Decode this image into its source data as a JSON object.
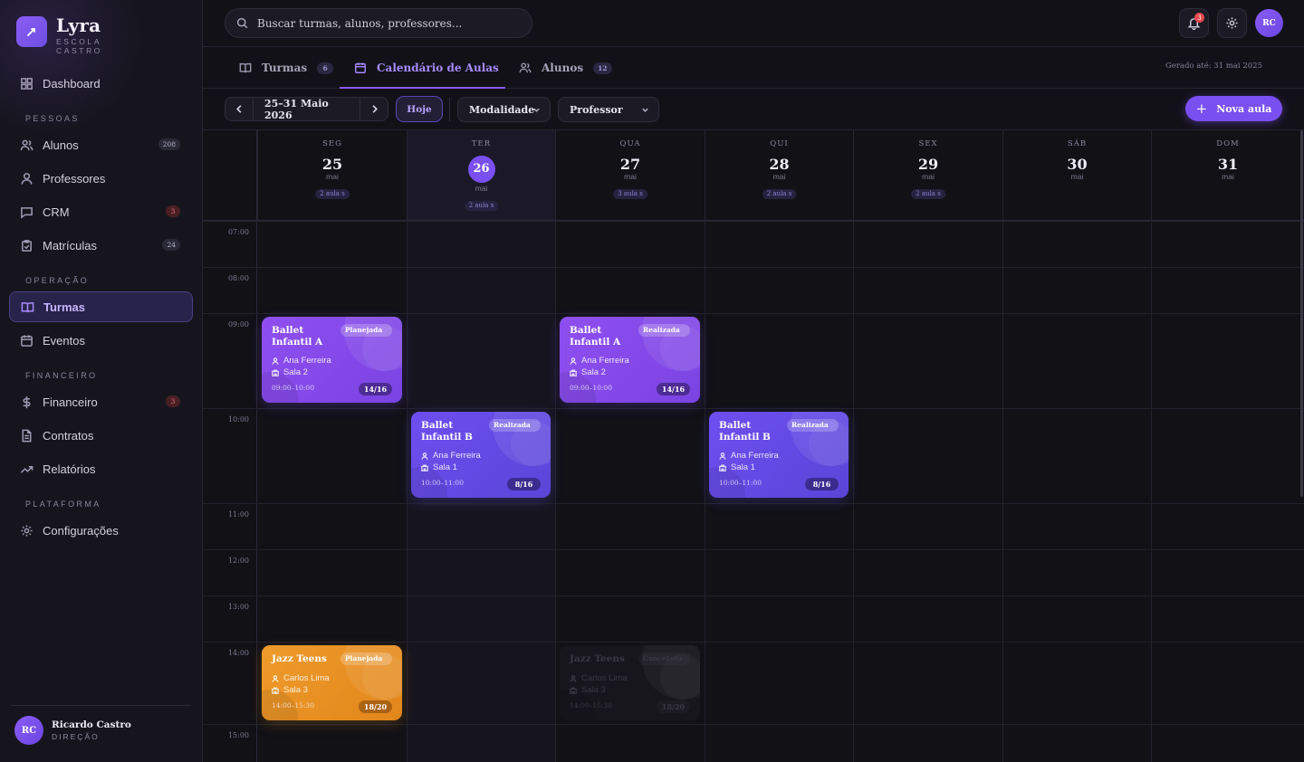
{
  "brand": {
    "name": "Lyra",
    "subtitle": "ESCOLA CASTRO"
  },
  "sidebar": {
    "dashboard": "Dashboard",
    "sections": {
      "pessoas": "PESSOAS",
      "operacao": "OPERAÇÃO",
      "financeiro": "FINANCEIRO",
      "plataforma": "PLATAFORMA"
    },
    "items": {
      "alunos": {
        "label": "Alunos",
        "badge": "208"
      },
      "professores": {
        "label": "Professores"
      },
      "crm": {
        "label": "CRM",
        "badge": "3"
      },
      "matriculas": {
        "label": "Matrículas",
        "badge": "24"
      },
      "turmas": {
        "label": "Turmas"
      },
      "eventos": {
        "label": "Eventos"
      },
      "financeiro": {
        "label": "Financeiro",
        "badge": "3"
      },
      "contratos": {
        "label": "Contratos"
      },
      "relatorios": {
        "label": "Relatórios"
      },
      "configuracoes": {
        "label": "Configurações"
      }
    },
    "user": {
      "initials": "RC",
      "name": "Ricardo Castro",
      "role": "DIREÇÃO"
    }
  },
  "topbar": {
    "search_placeholder": "Buscar turmas, alunos, professores...",
    "notifications": "3",
    "avatar": "RC"
  },
  "tabs": {
    "turmas": {
      "label": "Turmas",
      "count": "6"
    },
    "calendario": {
      "label": "Calendário de Aulas"
    },
    "alunos": {
      "label": "Alunos",
      "count": "12"
    },
    "generated": "Gerado até: 31 mai 2025"
  },
  "toolbar": {
    "range": "25–31 Maio 2026",
    "today": "Hoje",
    "modalidade": "Modalidade",
    "professor": "Professor",
    "new_class": "Nova aula"
  },
  "days": [
    {
      "name": "SEG",
      "num": "25",
      "month": "mai",
      "pill": "2 aula s"
    },
    {
      "name": "TER",
      "num": "26",
      "month": "mai",
      "pill": "2 aula s"
    },
    {
      "name": "QUA",
      "num": "27",
      "month": "mai",
      "pill": "3 aula s"
    },
    {
      "name": "QUI",
      "num": "28",
      "month": "mai",
      "pill": "2 aula s"
    },
    {
      "name": "SEX",
      "num": "29",
      "month": "mai",
      "pill": "2 aula s"
    },
    {
      "name": "SÁB",
      "num": "30",
      "month": "mai"
    },
    {
      "name": "DOM",
      "num": "31",
      "month": "mai"
    }
  ],
  "hours": [
    "07:00",
    "08:00",
    "09:00",
    "10:00",
    "11:00",
    "12:00",
    "13:00",
    "14:00",
    "15:00"
  ],
  "events": [
    {
      "title": "Ballet Infantil A",
      "status": "Planejada",
      "teacher": "Ana Ferreira",
      "room": "Sala 2",
      "time": "09:00–10:00",
      "capacity": "14/16"
    },
    {
      "title": "Ballet Infantil A",
      "status": "Realizada",
      "teacher": "Ana Ferreira",
      "room": "Sala 2",
      "time": "09:00–10:00",
      "capacity": "14/16"
    },
    {
      "title": "Ballet Infantil B",
      "status": "Realizada",
      "teacher": "Ana Ferreira",
      "room": "Sala 1",
      "time": "10:00–11:00",
      "capacity": "8/16"
    },
    {
      "title": "Ballet Infantil B",
      "status": "Realizada",
      "teacher": "Ana Ferreira",
      "room": "Sala 1",
      "time": "10:00–11:00",
      "capacity": "8/16"
    },
    {
      "title": "Jazz Teens",
      "status": "Planejada",
      "teacher": "Carlos Lima",
      "room": "Sala 3",
      "time": "14:00–15:30",
      "capacity": "18/20"
    },
    {
      "title": "Jazz Teens",
      "status": "Cancelada",
      "teacher": "Carlos Lima",
      "room": "Sala 3",
      "time": "14:00–15:30",
      "capacity": "18/20"
    }
  ]
}
